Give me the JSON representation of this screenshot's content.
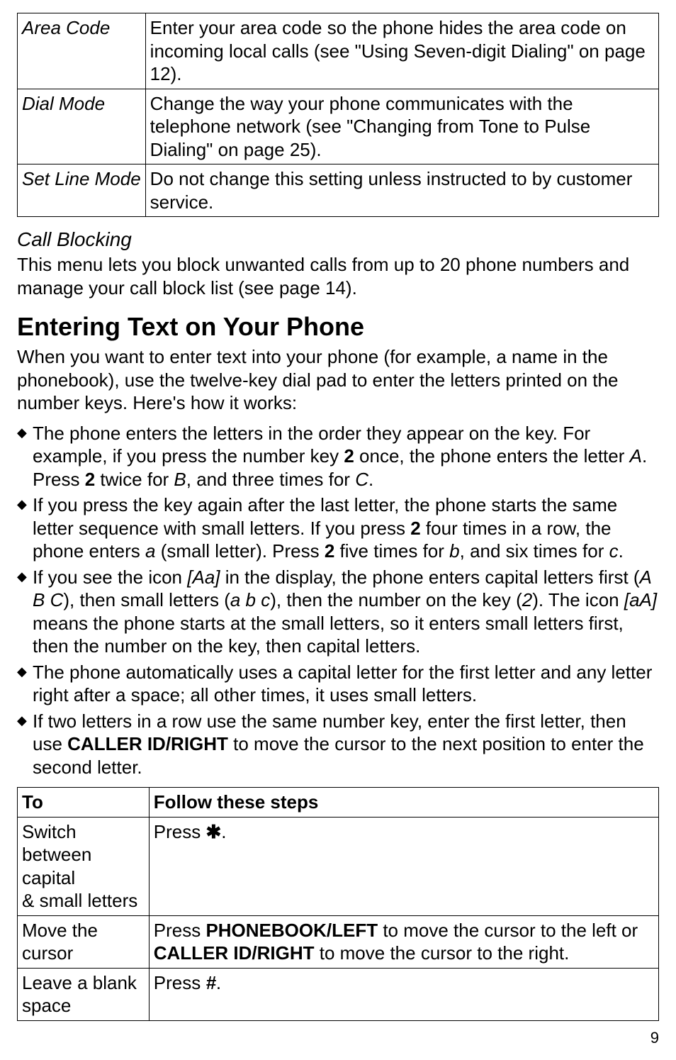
{
  "topTable": {
    "rows": [
      {
        "label": "Area Code",
        "desc": "Enter your area code so the phone hides the area code on incoming local calls (see \"Using Seven-digit Dialing\" on page 12)."
      },
      {
        "label": "Dial Mode",
        "desc": "Change the way your phone communicates with the telephone network (see \"Changing from Tone to Pulse Dialing\" on page 25)."
      },
      {
        "label": "Set Line Mode",
        "desc": "Do not change this setting unless instructed to by customer service."
      }
    ]
  },
  "callBlocking": {
    "heading": "Call Blocking",
    "body": "This menu lets you block unwanted calls from up to 20 phone numbers and manage your call block list (see page 14)."
  },
  "enteringText": {
    "heading": "Entering Text on Your Phone",
    "intro": "When you want to enter text into your phone (for example, a name in the phonebook), use the twelve-key dial pad to enter the letters printed on the number keys. Here's how it works:"
  },
  "bullets": {
    "b1_a": "The phone enters the letters in the order they appear on the key. For example, if you press the number key ",
    "b1_key": "2",
    "b1_b": " once, the phone enters the letter ",
    "b1_letterA": "A",
    "b1_c": ". Press ",
    "b1_d": " twice for ",
    "b1_letterB": "B",
    "b1_e": ", and three times for ",
    "b1_letterC": "C",
    "b1_f": ".",
    "b2_a": "If you press the key again after the last letter, the phone starts the same letter sequence with small letters. If you press ",
    "b2_key": "2",
    "b2_b": " four times in a row, the phone enters ",
    "b2_letter_a": "a",
    "b2_c": " (small letter). Press ",
    "b2_d": " five times for ",
    "b2_letter_b": "b",
    "b2_e": ", and six times for ",
    "b2_letter_c": "c",
    "b2_f": ".",
    "b3_a": "If you see the icon ",
    "b3_icon1": "[Aa]",
    "b3_b": " in the display, the phone enters capital letters first (",
    "b3_ABC": "A B C",
    "b3_c": "), then small letters (",
    "b3_abc": "a b c",
    "b3_d": "), then the number on the key (",
    "b3_num": "2",
    "b3_e": "). The icon ",
    "b3_icon2": "[aA]",
    "b3_f": " means the phone starts at the small letters, so it enters small letters first, then the number on the key, then capital letters.",
    "b4": "The phone automatically uses a capital letter for the first letter and any letter right after a space; all other times, it uses small letters.",
    "b5_a": "If two letters in a row use the same number key, enter the first letter, then use ",
    "b5_key": "CALLER ID/RIGHT",
    "b5_b": " to move the cursor to the next position to enter the second letter."
  },
  "stepsTable": {
    "headers": {
      "to": "To",
      "steps": "Follow these steps"
    },
    "rows": {
      "r1": {
        "to_a": "Switch between capital",
        "to_b": "& small letters",
        "steps_a": "Press ",
        "steps_star": "✱",
        "steps_b": "."
      },
      "r2": {
        "to": "Move the cursor",
        "steps_a": "Press ",
        "steps_k1": "PHONEBOOK/LEFT",
        "steps_b": " to move the cursor to the left or ",
        "steps_k2": "CALLER ID/RIGHT",
        "steps_c": " to move the cursor to the right."
      },
      "r3": {
        "to": "Leave a blank space",
        "steps_a": "Press ",
        "steps_hash": "#",
        "steps_b": "."
      }
    }
  },
  "pageNumber": "9",
  "chart_data": null
}
